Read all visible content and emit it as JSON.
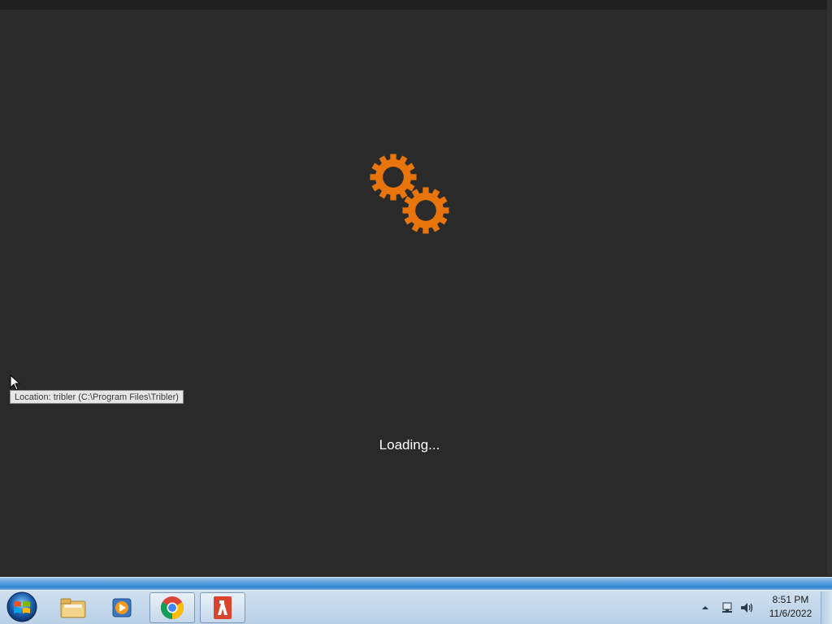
{
  "app": {
    "loading_label": "Loading...",
    "accent_color": "#e8740c",
    "background_color": "#2a2a2a"
  },
  "tooltip": {
    "text": "Location: tribler (C:\\Program Files\\Tribler)"
  },
  "taskbar": {
    "start_icon": "windows-orb-icon",
    "pinned": [
      {
        "name": "Windows Explorer",
        "icon": "folder-icon"
      },
      {
        "name": "Windows Media Player",
        "icon": "media-player-icon"
      },
      {
        "name": "Google Chrome",
        "icon": "chrome-icon",
        "active": true
      },
      {
        "name": "Tribler",
        "icon": "tribler-icon",
        "active": true
      }
    ],
    "tray_icons": [
      "show-hidden-icons-chevron",
      "network-icon",
      "volume-icon"
    ],
    "clock": {
      "time": "8:51 PM",
      "date": "11/6/2022"
    }
  }
}
